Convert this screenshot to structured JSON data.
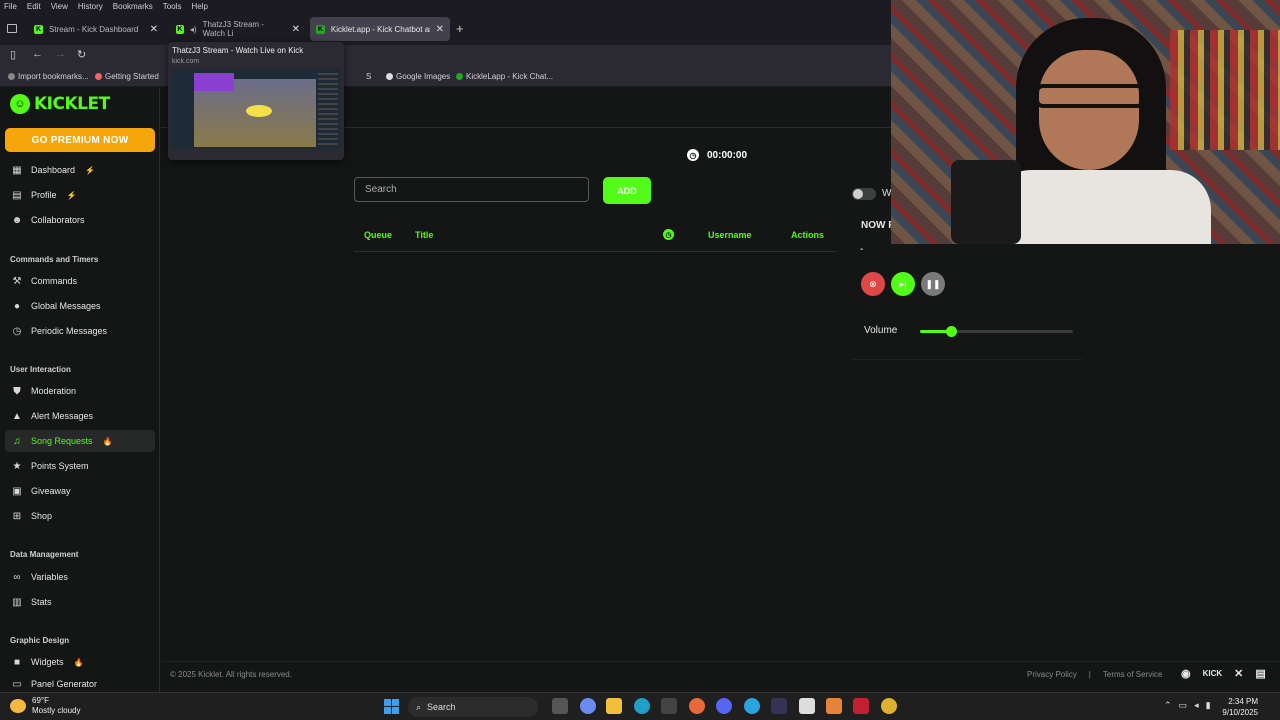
{
  "menubar": [
    "File",
    "Edit",
    "View",
    "History",
    "Bookmarks",
    "Tools",
    "Help"
  ],
  "tabs": [
    {
      "label": "Stream - Kick Dashboard"
    },
    {
      "label": "ThatzJ3 Stream - Watch Li"
    },
    {
      "label": "Kicklet.app - Kick Chatbot and C"
    }
  ],
  "tab_preview": {
    "title": "ThatzJ3 Stream - Watch Live on Kick",
    "url": "kick.com"
  },
  "bookmarks": [
    {
      "label": "Import bookmarks..."
    },
    {
      "label": "Getting Started"
    },
    {
      "label": "S"
    },
    {
      "label": "Google Images"
    },
    {
      "label": "KickleLapp - Kick Chat..."
    }
  ],
  "sidebar": {
    "logo": "KICKLET",
    "premium": "GO PREMIUM NOW",
    "items": [
      {
        "label": "Dashboard",
        "icon": "grid-icon",
        "badge": "⚡"
      },
      {
        "label": "Profile",
        "icon": "profile-icon",
        "badge": "⚡"
      },
      {
        "label": "Collaborators",
        "icon": "users-icon"
      },
      {
        "label": "Commands",
        "icon": "wrench-icon"
      },
      {
        "label": "Global Messages",
        "icon": "chat-icon"
      },
      {
        "label": "Periodic Messages",
        "icon": "clock-icon"
      },
      {
        "label": "Moderation",
        "icon": "shield-icon"
      },
      {
        "label": "Alert Messages",
        "icon": "alert-icon"
      },
      {
        "label": "Song Requests",
        "icon": "music-icon",
        "badge": "🔥"
      },
      {
        "label": "Points System",
        "icon": "star-icon"
      },
      {
        "label": "Giveaway",
        "icon": "gift-icon"
      },
      {
        "label": "Shop",
        "icon": "cart-icon"
      },
      {
        "label": "Variables",
        "icon": "link-icon"
      },
      {
        "label": "Stats",
        "icon": "chart-icon"
      },
      {
        "label": "Widgets",
        "icon": "video-icon",
        "badge": "🔥"
      },
      {
        "label": "Panel Generator",
        "icon": "panel-icon"
      }
    ],
    "sections": [
      "Commands and Timers",
      "User Interaction",
      "Data Management",
      "Graphic Design"
    ]
  },
  "main": {
    "timer": "00:00:00",
    "search_placeholder": "Search",
    "add_label": "ADD",
    "columns": [
      "Queue",
      "Title",
      "Username",
      "Actions"
    ]
  },
  "now_playing": {
    "toggle_label": "W",
    "title": "NOW P",
    "track": "-",
    "volume_label": "Volume",
    "volume_level": 0.2
  },
  "footer": {
    "copyright": "© 2025 Kicklet. All rights reserved.",
    "privacy": "Privacy Policy",
    "separator": "|",
    "terms": "Terms of Service"
  },
  "taskbar": {
    "weather_temp": "69°F",
    "weather_desc": "Mostly cloudy",
    "search": "Search",
    "time": "2:34 PM",
    "date": "9/10/2025"
  },
  "colors": {
    "accent": "#53fc18",
    "premium": "#f5a60b",
    "stop": "#e04848",
    "pause": "#7a7a7a"
  }
}
